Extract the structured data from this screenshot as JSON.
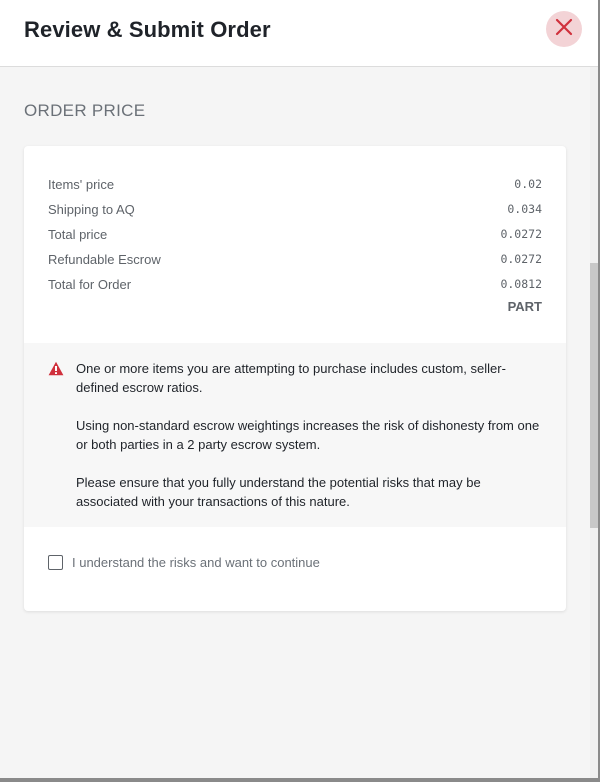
{
  "modal": {
    "title": "Review & Submit Order",
    "close_icon": "close-icon"
  },
  "order_price": {
    "section_title": "ORDER PRICE",
    "rows": [
      {
        "label": "Items' price",
        "value": "0.02"
      },
      {
        "label": "Shipping to AQ",
        "value": "0.034"
      },
      {
        "label": "Total price",
        "value": "0.0272"
      },
      {
        "label": "Refundable Escrow",
        "value": "0.0272"
      },
      {
        "label": "Total for Order",
        "value": "0.0812"
      }
    ],
    "currency": "PART"
  },
  "warning": {
    "icon": "warning-triangle-icon",
    "paragraphs": [
      "One or more items you are attempting to purchase includes custom, seller-defined escrow ratios.",
      "Using non-standard escrow weightings increases the risk of dishonesty from one or both parties in a 2 party escrow system.",
      "Please ensure that you fully understand the potential risks that may be associated with your transactions of this nature."
    ]
  },
  "acknowledge": {
    "label": "I understand the risks and want to continue",
    "checked": false
  },
  "colors": {
    "close_bg": "#f3d3d6",
    "close_icon": "#d0303c",
    "warning_icon": "#d0303c"
  }
}
